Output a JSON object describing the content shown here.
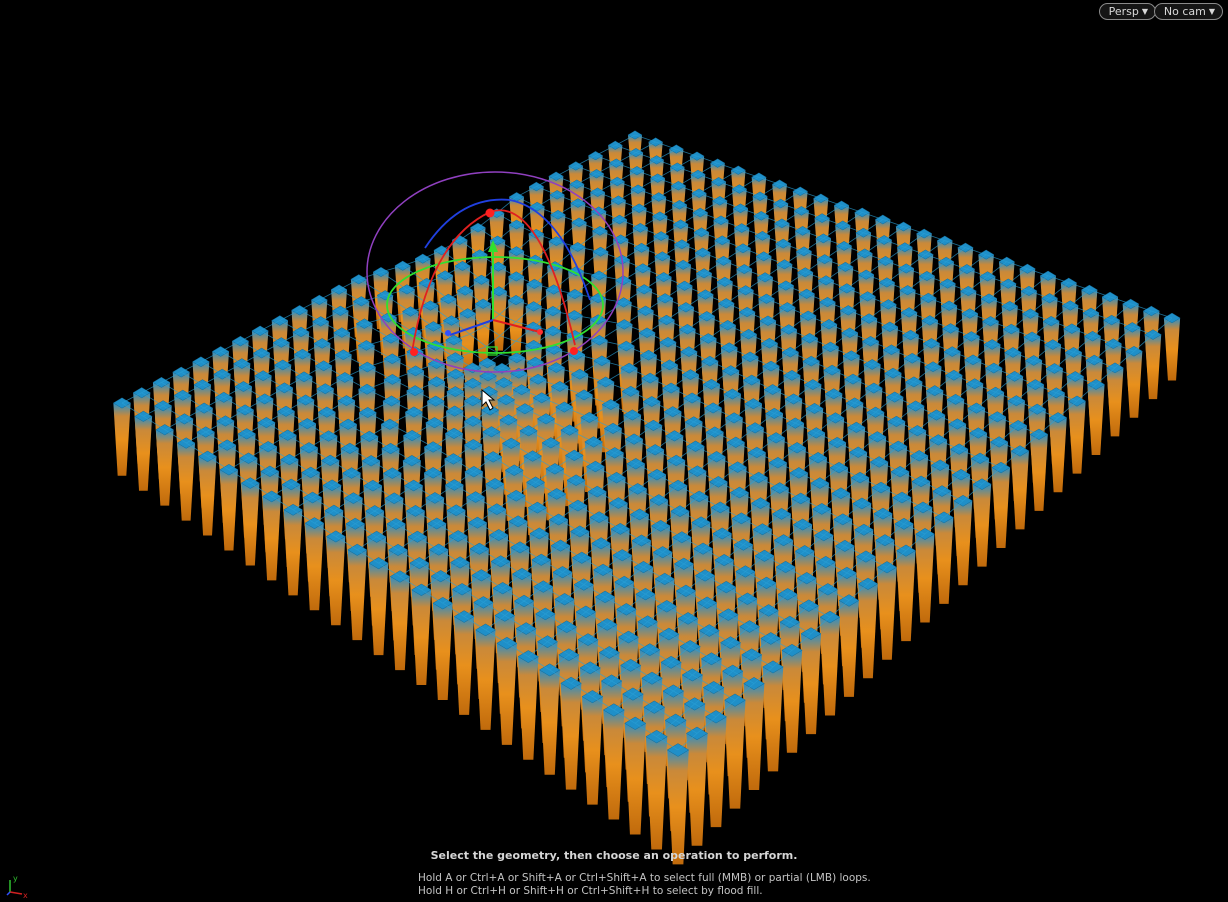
{
  "viewport": {
    "camera_view_label": "Persp",
    "camera_select_label": "No cam"
  },
  "hints": {
    "title": "Select the geometry, then choose an operation to perform.",
    "line1": "Hold A or Ctrl+A or Shift+A or Ctrl+Shift+A to select full (MMB) or partial (LMB) loops.",
    "line2": "Hold H or Ctrl+H or Shift+H or Ctrl+Shift+H to select by flood fill."
  },
  "axis_gizmo": {
    "x_label": "x",
    "y_label": "y"
  },
  "colors": {
    "background": "#000000",
    "column_side": "#e08a1c",
    "column_top": "#1f8fc8",
    "wireframe": "#2a9fd6",
    "handle_x": "#e02020",
    "handle_y": "#30e030",
    "handle_z": "#2040e0",
    "handle_view": "#9040c0"
  },
  "icons": [
    "caret-down-icon",
    "mouse-cursor-icon",
    "axis-gizmo-icon",
    "transform-handle-icon"
  ]
}
